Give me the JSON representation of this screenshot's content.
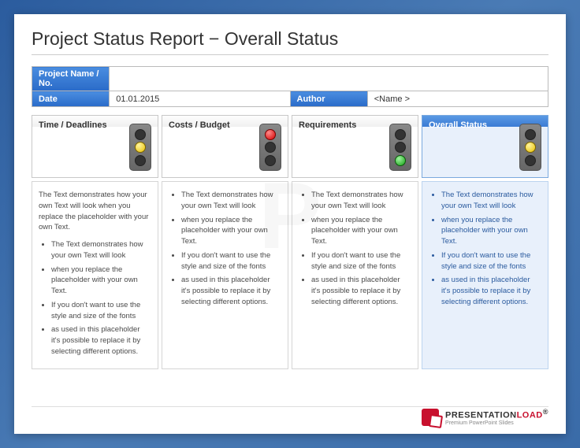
{
  "title": "Project Status Report − Overall Status",
  "info": {
    "projectLabel": "Project Name / No.",
    "projectValue": "",
    "dateLabel": "Date",
    "dateValue": "01.01.2015",
    "authorLabel": "Author",
    "authorValue": "<Name >"
  },
  "columns": [
    {
      "label": "Time / Deadlines",
      "light": "yellow",
      "intro": "The Text demonstrates how your own Text will look when you replace the placeholder with your own Text.",
      "bullets": [
        "The Text demonstrates how your own Text will look",
        "when you replace the placeholder with your own Text.",
        "If you don't want to use the style and size of the fonts",
        "as used in this placeholder it's possible to replace it by selecting different options."
      ]
    },
    {
      "label": "Costs / Budget",
      "light": "red",
      "intro": "",
      "bullets": [
        "The Text demonstrates how your own Text will look",
        "when you replace the placeholder with your own Text.",
        "If you don't want to use the style and size of the fonts",
        "as used in this placeholder it's possible to replace it by selecting different options."
      ]
    },
    {
      "label": "Requirements",
      "light": "green",
      "intro": "",
      "bullets": [
        "The Text demonstrates how your own Text will look",
        "when you replace the placeholder with your own Text.",
        "If you don't want to use the style and size of the fonts",
        "as used in this placeholder it's possible to replace it by selecting different options."
      ]
    },
    {
      "label": "Overall Status",
      "light": "yellow",
      "intro": "",
      "bullets": [
        "The Text demonstrates how your own Text will look",
        "when you replace the placeholder with your own Text.",
        "If you don't want to use the style and size of the fonts",
        "as used in this placeholder it's possible to replace it by selecting different options."
      ]
    }
  ],
  "footer": {
    "brand1": "PRESENTATION",
    "brand2": "LOAD",
    "reg": "®",
    "tagline": "Premium PowerPoint Slides"
  }
}
